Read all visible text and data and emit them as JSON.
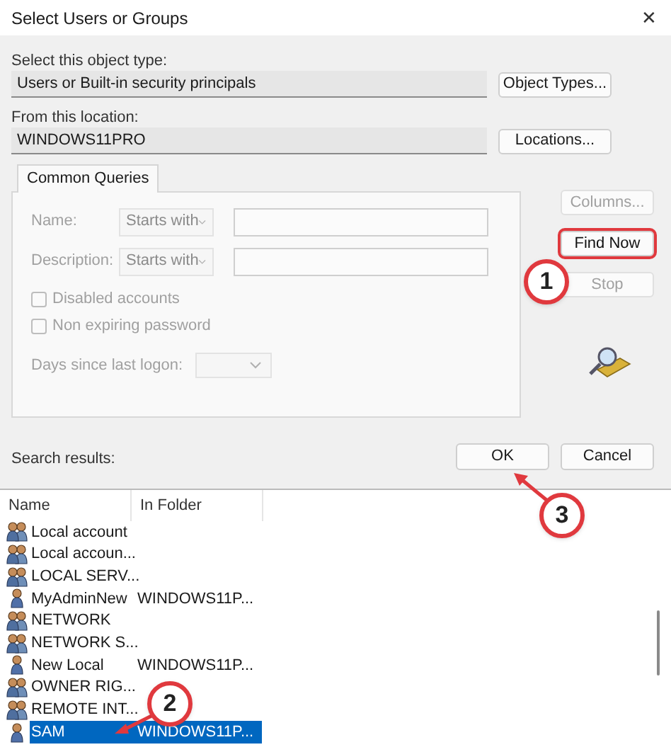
{
  "window": {
    "title": "Select Users or Groups",
    "close": "✕"
  },
  "object_type": {
    "label": "Select this object type:",
    "value": "Users or Built-in security principals",
    "button": "Object Types..."
  },
  "location": {
    "label": "From this location:",
    "value": "WINDOWS11PRO",
    "button": "Locations..."
  },
  "tabs": [
    {
      "label": "Common Queries",
      "selected": true
    }
  ],
  "query": {
    "disabled": true,
    "fields": [
      {
        "label": "Name:",
        "mode": "Starts with"
      },
      {
        "label": "Description:",
        "mode": "Starts with"
      }
    ],
    "checkboxes": [
      {
        "label": "Disabled accounts",
        "checked": false
      },
      {
        "label": "Non expiring password",
        "checked": false
      }
    ],
    "days_label": "Days since last logon:"
  },
  "side_buttons": [
    {
      "label": "Columns...",
      "disabled": true,
      "highlighted": false
    },
    {
      "label": "Find Now",
      "disabled": false,
      "highlighted": true
    },
    {
      "label": "Stop",
      "disabled": true,
      "highlighted": false
    }
  ],
  "ok": "OK",
  "cancel": "Cancel",
  "results": {
    "label": "Search results:",
    "columns": [
      "Name",
      "In Folder"
    ],
    "rows": [
      {
        "kind": "group",
        "name": "Local account",
        "folder": "",
        "selected": false
      },
      {
        "kind": "group",
        "name": "Local accoun...",
        "folder": "",
        "selected": false
      },
      {
        "kind": "group",
        "name": "LOCAL SERV...",
        "folder": "",
        "selected": false
      },
      {
        "kind": "user",
        "name": "MyAdminNew",
        "folder": "WINDOWS11P...",
        "selected": false
      },
      {
        "kind": "group",
        "name": "NETWORK",
        "folder": "",
        "selected": false
      },
      {
        "kind": "group",
        "name": "NETWORK S...",
        "folder": "",
        "selected": false
      },
      {
        "kind": "user",
        "name": "New Local",
        "folder": "WINDOWS11P...",
        "selected": false
      },
      {
        "kind": "group",
        "name": "OWNER RIG...",
        "folder": "",
        "selected": false
      },
      {
        "kind": "group",
        "name": "REMOTE INT...",
        "folder": "",
        "selected": false
      },
      {
        "kind": "user",
        "name": "SAM",
        "folder": "WINDOWS11P...",
        "selected": true
      }
    ]
  },
  "callouts": [
    {
      "label": "1"
    },
    {
      "label": "2"
    },
    {
      "label": "3"
    }
  ]
}
